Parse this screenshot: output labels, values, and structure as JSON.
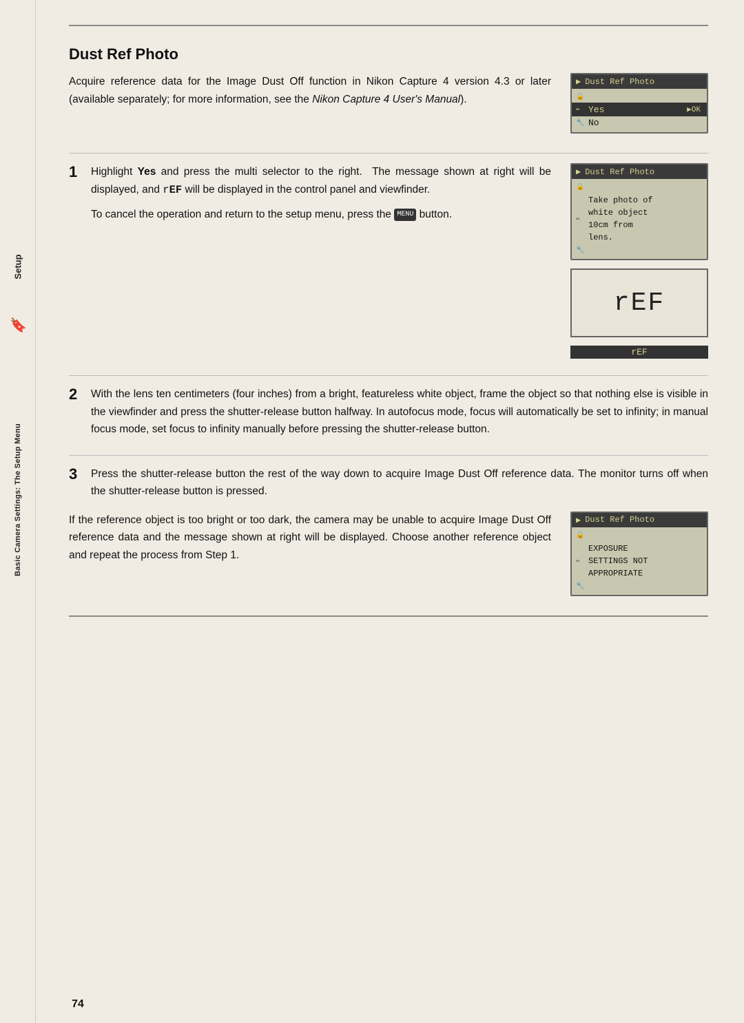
{
  "page": {
    "number": "74",
    "top_line": true,
    "bottom_line": true
  },
  "sidebar": {
    "setup_label": "Setup",
    "basic_label": "Basic Camera Settings: The Setup Menu",
    "bookmark_icon": "🔖"
  },
  "title": "Dust Ref Photo",
  "intro": {
    "text": "Acquire reference data for the Image Dust Off function in Nikon Capture 4 version 4.3 or later (available separately; for more information, see the ",
    "italic": "Nikon Capture 4 User's Manual",
    "text_end": ")."
  },
  "lcd1": {
    "header": "Dust Ref Photo",
    "rows": [
      {
        "icon": "▶",
        "text": "",
        "type": "arrow"
      },
      {
        "icon": "🔒",
        "text": "Yes",
        "ok": "▶OK",
        "selected": true
      },
      {
        "icon": "✏",
        "text": "No",
        "selected": false
      },
      {
        "icon": "🔧",
        "text": "",
        "type": "blank"
      }
    ]
  },
  "step1": {
    "number": "1",
    "text": "Highlight ",
    "bold": "Yes",
    "text2": " and press the multi selector to the right.  The message shown at right will be displayed, and ",
    "code": "rEF",
    "text3": " will be displayed in the control panel and viewfinder.",
    "sub_text": "To cancel the operation and return to the setup menu, press the ",
    "menu_icon": "MENU",
    "sub_end": " button."
  },
  "lcd2": {
    "header": "Dust Ref Photo",
    "body": "Take photo of\nwhite object\n10cm from\nlens."
  },
  "ref_display": {
    "large_text": "rEF",
    "bottom_bar": "rEF"
  },
  "step2": {
    "number": "2",
    "text": "With the lens ten centimeters (four inches) from a bright, featureless white object, frame the object so that nothing else is visible in the viewfinder and press the shutter-release button halfway.  In autofocus mode, focus will automatically be set to infinity; in manual focus mode, set focus to infinity manually before pressing the shutter-release button."
  },
  "step3": {
    "number": "3",
    "text": "Press the shutter-release button the rest of the way down to acquire Image Dust Off reference data.  The monitor turns off when the shutter-release button is pressed."
  },
  "step3_note": {
    "text": "If the reference object is too bright or too dark, the camera may be unable to acquire Image Dust Off reference data and the message shown at right will be displayed. Choose another reference object and repeat the process from Step 1."
  },
  "lcd3": {
    "header": "Dust Ref Photo",
    "body": "EXPOSURE\nSETTINGS NOT\nAPPROPRIATE"
  }
}
